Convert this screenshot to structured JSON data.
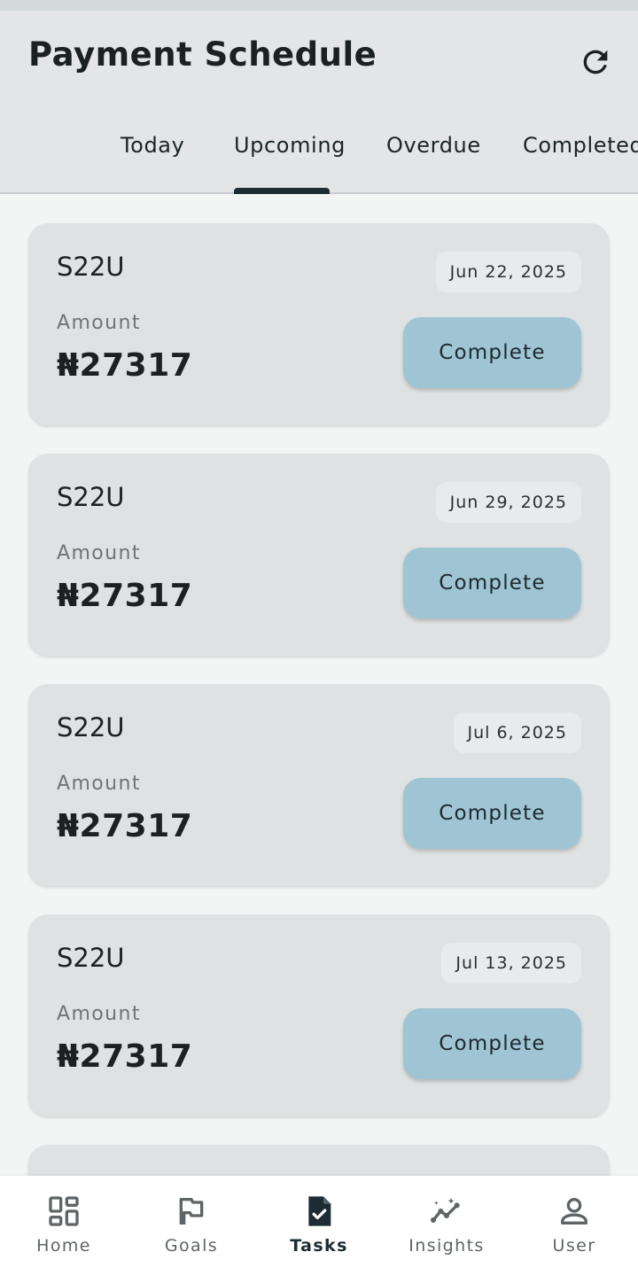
{
  "header": {
    "title": "Payment Schedule",
    "refresh_icon": "refresh-icon"
  },
  "tabs": [
    {
      "label": "Today",
      "active": false
    },
    {
      "label": "Upcoming",
      "active": true
    },
    {
      "label": "Overdue",
      "active": false
    },
    {
      "label": "Completed",
      "active": false
    }
  ],
  "payments": [
    {
      "name": "S22U",
      "date": "Jun 22, 2025",
      "amount_label": "Amount",
      "amount": "₦27317",
      "button": "Complete"
    },
    {
      "name": "S22U",
      "date": "Jun 29, 2025",
      "amount_label": "Amount",
      "amount": "₦27317",
      "button": "Complete"
    },
    {
      "name": "S22U",
      "date": "Jul 6, 2025",
      "amount_label": "Amount",
      "amount": "₦27317",
      "button": "Complete"
    },
    {
      "name": "S22U",
      "date": "Jul 13, 2025",
      "amount_label": "Amount",
      "amount": "₦27317",
      "button": "Complete"
    }
  ],
  "bottom_nav": [
    {
      "label": "Home",
      "icon": "dashboard-icon",
      "active": false
    },
    {
      "label": "Goals",
      "icon": "flag-icon",
      "active": false
    },
    {
      "label": "Tasks",
      "icon": "task-document-icon",
      "active": true
    },
    {
      "label": "Insights",
      "icon": "insights-chart-icon",
      "active": false
    },
    {
      "label": "User",
      "icon": "user-icon",
      "active": false
    }
  ],
  "colors": {
    "header_bg": "#e3e5e7",
    "card_bg": "#dfe2e3",
    "button_bg": "#9fc4d4",
    "indicator": "#1e2d33",
    "page_bg": "#f3f5f5"
  }
}
